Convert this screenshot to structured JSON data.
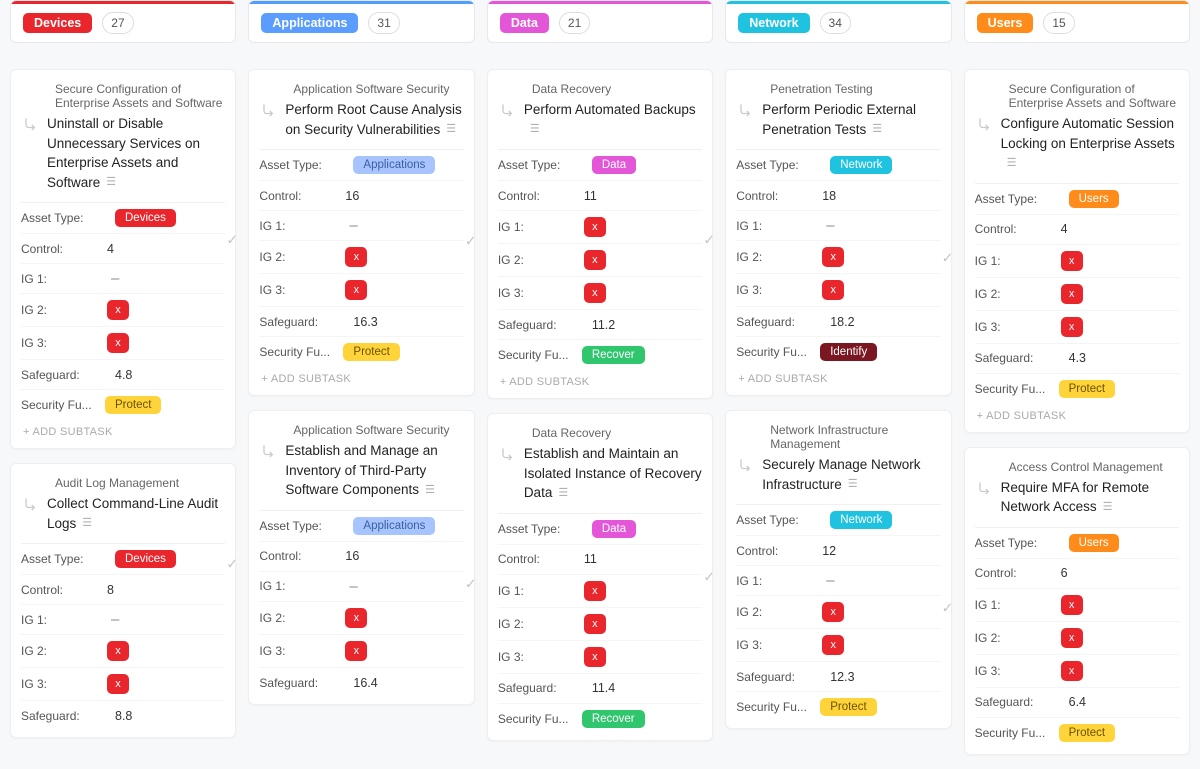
{
  "labels": {
    "asset_type": "Asset Type:",
    "control": "Control:",
    "ig1": "IG 1:",
    "ig2": "IG 2:",
    "ig3": "IG 3:",
    "safeguard": "Safeguard:",
    "security_fu": "Security Fu...",
    "add_subtask": "+ ADD SUBTASK",
    "x": "x",
    "dash": "–"
  },
  "asset_tags": {
    "Devices": {
      "bg": "bg-red"
    },
    "Applications": {
      "bg": "bg-blue-light"
    },
    "Data": {
      "bg": "bg-magenta"
    },
    "Network": {
      "bg": "bg-cyan"
    },
    "Users": {
      "bg": "bg-orange"
    }
  },
  "func_tags": {
    "Protect": {
      "bg": "bg-yellow"
    },
    "Recover": {
      "bg": "bg-green"
    },
    "Identify": {
      "bg": "bg-darkred"
    }
  },
  "columns": [
    {
      "name": "Devices",
      "count": 27,
      "pill_bg": "bg-red",
      "bar": "bar-red",
      "cards": [
        {
          "category": "Secure Configuration of Enterprise Assets and Software",
          "title": "Uninstall or Disable Unnecessary Services on Enterprise Assets and Software",
          "asset": "Devices",
          "control": "4",
          "ig1": "dash",
          "ig2": "x",
          "ig3": "x",
          "safeguard": "4.8",
          "func": "Protect",
          "add": true
        },
        {
          "category": "Audit Log Management",
          "title": "Collect Command-Line Audit Logs",
          "asset": "Devices",
          "control": "8",
          "ig1": "dash",
          "ig2": "x",
          "ig3": "x",
          "safeguard": "8.8",
          "func": null,
          "add": false
        }
      ]
    },
    {
      "name": "Applications",
      "count": 31,
      "pill_bg": "bg-blue",
      "bar": "bar-blue",
      "cards": [
        {
          "category": "Application Software Security",
          "title": "Perform Root Cause Analysis on Security Vulnerabilities",
          "asset": "Applications",
          "control": "16",
          "ig1": "dash",
          "ig2": "x",
          "ig3": "x",
          "safeguard": "16.3",
          "func": "Protect",
          "add": true
        },
        {
          "category": "Application Software Security",
          "title": "Establish and Manage an Inventory of Third-Party Software Components",
          "asset": "Applications",
          "control": "16",
          "ig1": "dash",
          "ig2": "x",
          "ig3": "x",
          "safeguard": "16.4",
          "func": null,
          "add": false
        }
      ]
    },
    {
      "name": "Data",
      "count": 21,
      "pill_bg": "bg-magenta",
      "bar": "bar-magenta",
      "cards": [
        {
          "category": "Data Recovery",
          "title": "Perform Automated Backups",
          "asset": "Data",
          "control": "11",
          "ig1": "x",
          "ig2": "x",
          "ig3": "x",
          "safeguard": "11.2",
          "func": "Recover",
          "add": true
        },
        {
          "category": "Data Recovery",
          "title": "Establish and Maintain an Isolated Instance of Recovery Data",
          "asset": "Data",
          "control": "11",
          "ig1": "x",
          "ig2": "x",
          "ig3": "x",
          "safeguard": "11.4",
          "func": "Recover",
          "add": false
        }
      ]
    },
    {
      "name": "Network",
      "count": 34,
      "pill_bg": "bg-cyan",
      "bar": "bar-cyan",
      "cards": [
        {
          "category": "Penetration Testing",
          "title": "Perform Periodic External Penetration Tests",
          "asset": "Network",
          "control": "18",
          "ig1": "dash",
          "ig2": "x",
          "ig3": "x",
          "safeguard": "18.2",
          "func": "Identify",
          "add": true
        },
        {
          "category": "Network Infrastructure Management",
          "title": "Securely Manage Network Infrastructure",
          "asset": "Network",
          "control": "12",
          "ig1": "dash",
          "ig2": "x",
          "ig3": "x",
          "safeguard": "12.3",
          "func": "Protect",
          "add": false
        }
      ]
    },
    {
      "name": "Users",
      "count": 15,
      "pill_bg": "bg-orange",
      "bar": "bar-orange",
      "cards": [
        {
          "category": "Secure Configuration of Enterprise Assets and Software",
          "title": "Configure Automatic Session Locking on Enterprise Assets",
          "asset": "Users",
          "control": "4",
          "ig1": "x",
          "ig2": "x",
          "ig3": "x",
          "safeguard": "4.3",
          "func": "Protect",
          "add": true
        },
        {
          "category": "Access Control Management",
          "title": "Require MFA for Remote Network Access",
          "asset": "Users",
          "control": "6",
          "ig1": "x",
          "ig2": "x",
          "ig3": "x",
          "safeguard": "6.4",
          "func": "Protect",
          "add": false
        }
      ]
    }
  ]
}
